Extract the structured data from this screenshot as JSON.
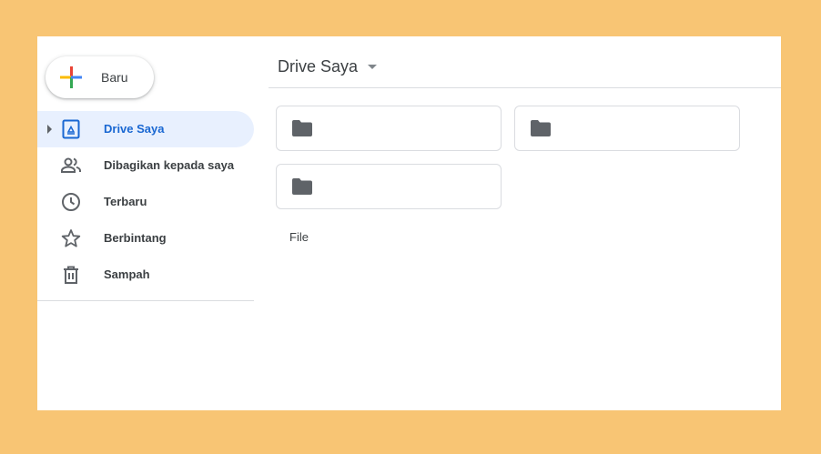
{
  "new_button": {
    "label": "Baru",
    "icon": "plus-icon"
  },
  "header": {
    "title": "Drive Saya",
    "dropdown_icon": "caret-down-icon"
  },
  "sidebar": {
    "items": [
      {
        "label": "Drive Saya",
        "icon": "drive-icon",
        "active": true
      },
      {
        "label": "Dibagikan kepada saya",
        "icon": "shared-people-icon"
      },
      {
        "label": "Terbaru",
        "icon": "clock-icon"
      },
      {
        "label": "Berbintang",
        "icon": "star-icon"
      },
      {
        "label": "Sampah",
        "icon": "trash-icon"
      }
    ]
  },
  "folders": [
    {
      "icon": "folder-icon",
      "name": ""
    },
    {
      "icon": "folder-icon",
      "name": ""
    },
    {
      "icon": "folder-icon",
      "name": ""
    }
  ],
  "files_section": {
    "label": "File"
  },
  "colors": {
    "background": "#f8c574",
    "active_nav_bg": "#e8f0fe",
    "active_nav_text": "#1967d2",
    "icon_gray": "#5f6368"
  }
}
